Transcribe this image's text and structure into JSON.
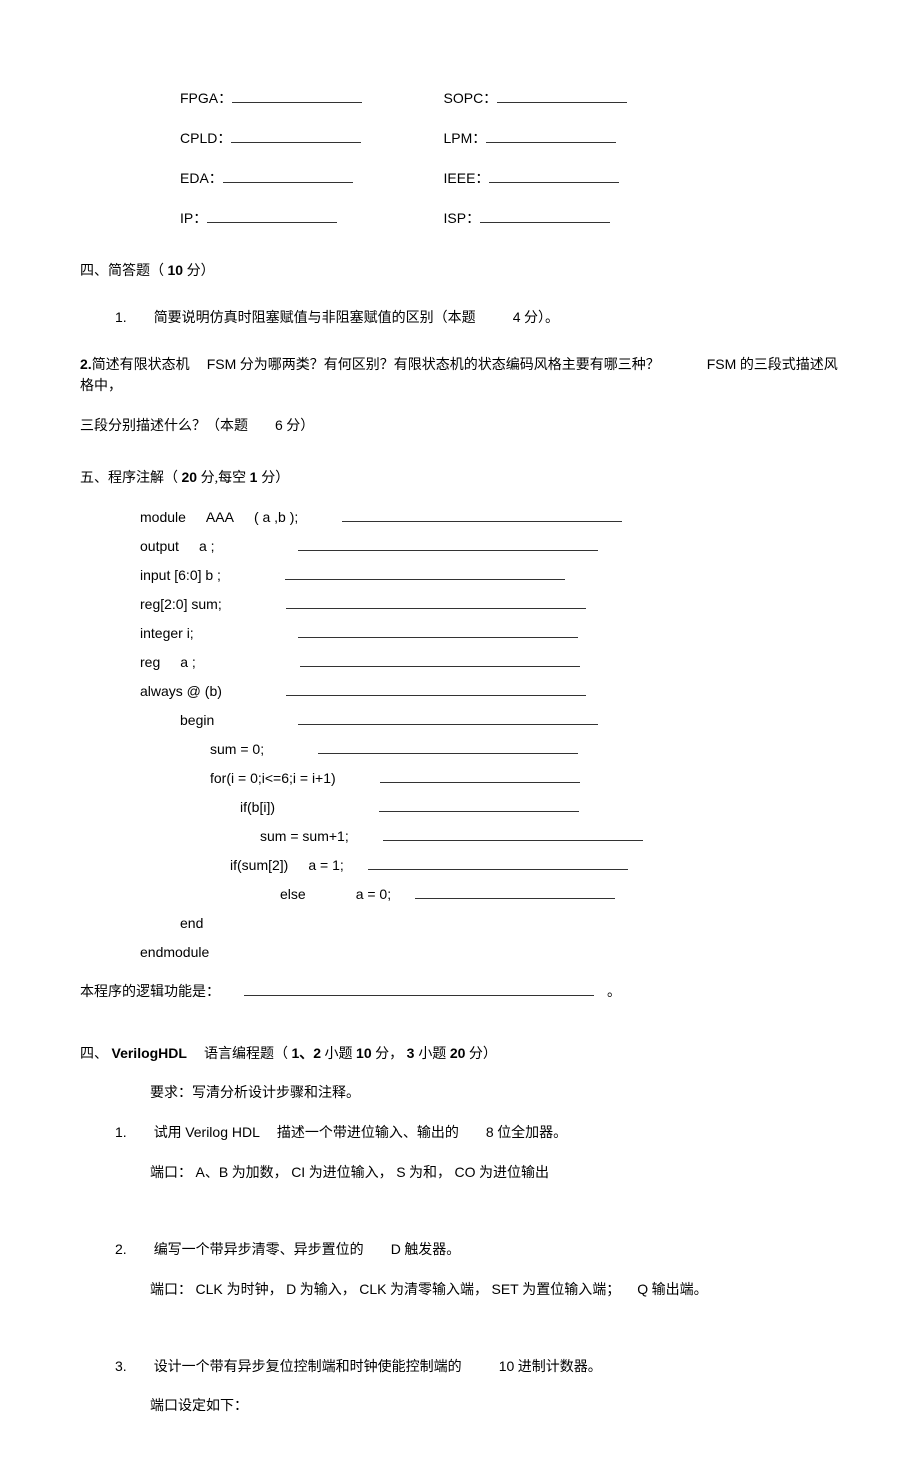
{
  "abbrs": {
    "r0": {
      "l1": "FPGA：",
      "l2": "SOPC："
    },
    "r1": {
      "l1": "CPLD：",
      "l2": "LPM："
    },
    "r2": {
      "l1": "EDA：",
      "l2": "IEEE："
    },
    "r3": {
      "l1": "IP：",
      "l2": "ISP："
    }
  },
  "section4": {
    "heading_a": "四、简答题（",
    "heading_b": "10",
    "heading_c": " 分）",
    "q1_num": "1.",
    "q1_text": "简要说明仿真时阻塞赋值与非阻塞赋值的区别（本题",
    "q1_pts_a": "4",
    "q1_pts_b": " 分）。",
    "q2_num": "2.",
    "q2_a": "简述有限状态机",
    "q2_b": "FSM",
    "q2_c": " 分为哪两类？有何区别？有限状态机的状态编码风格主要有哪三种？",
    "q2_d": "FSM",
    "q2_e": " 的三段式描述风格中，",
    "q2_f": "三段分别描述什么？（本题",
    "q2_g": "6",
    "q2_h": " 分）"
  },
  "section5": {
    "heading_a": "五、程序注解（",
    "heading_b": "20",
    "heading_c": " 分,每空",
    "heading_d": " 1 ",
    "heading_e": "分）",
    "code": {
      "l1a": "module",
      "l1b": "AAA",
      "l1c": "( a ,b );",
      "l2a": "output",
      "l2b": "a ;",
      "l3": "input [6:0] b ;",
      "l4": "reg[2:0] sum;",
      "l5": "integer i;",
      "l6a": "reg",
      "l6b": "a ;",
      "l7": "always @ (b)",
      "l8": "begin",
      "l9": "sum = 0;",
      "l10": "for(i = 0;i<=6;i = i+1)",
      "l11": "if(b[i])",
      "l12": "sum = sum+1;",
      "l13a": "if(sum[2])",
      "l13b": "a = 1;",
      "l14a": "else",
      "l14b": "a = 0;",
      "l15": "end",
      "l16": "endmodule"
    },
    "conclusion_a": "本程序的逻辑功能是：",
    "conclusion_end": "。"
  },
  "section4b": {
    "heading_a": "四、",
    "heading_b": "VerilogHDL",
    "heading_c": "语言编程题（",
    "heading_d": "1、2",
    "heading_e": " 小题",
    "heading_f": " 10",
    "heading_g": " 分，",
    "heading_h": "3 ",
    "heading_i": "小题",
    "heading_j": " 20",
    "heading_k": " 分）",
    "req": "要求：写清分析设计步骤和注释。",
    "q1_num": "1.",
    "q1_a": "试用",
    "q1_b": "Verilog HDL",
    "q1_c": "描述一个带进位输入、输出的",
    "q1_d": "8",
    "q1_e": " 位全加器。",
    "q1_f": "端口：",
    "q1_g": "A、B",
    "q1_h": " 为加数，",
    "q1_i": "CI",
    "q1_j": " 为进位输入，",
    "q1_k": "S",
    "q1_l": " 为和，",
    "q1_m": "CO",
    "q1_n": " 为进位输出",
    "q2_num": "2.",
    "q2_a": "编写一个带异步清零、异步置位的",
    "q2_b": "D",
    "q2_c": " 触发器。",
    "q2_d": "端口：",
    "q2_e": "CLK ",
    "q2_f": "为时钟，",
    "q2_g": "D",
    "q2_h": " 为输入，",
    "q2_i": "CLK",
    "q2_j": " 为清零输入端，",
    "q2_k": "SET",
    "q2_l": " 为置位输入端；",
    "q2_m": "Q",
    "q2_n": " 输出端。",
    "q3_num": "3.",
    "q3_a": "设计一个带有异步复位控制端和时钟使能控制端的",
    "q3_b": "10",
    "q3_c": " 进制计数器。",
    "q3_d": "端口设定如下："
  }
}
